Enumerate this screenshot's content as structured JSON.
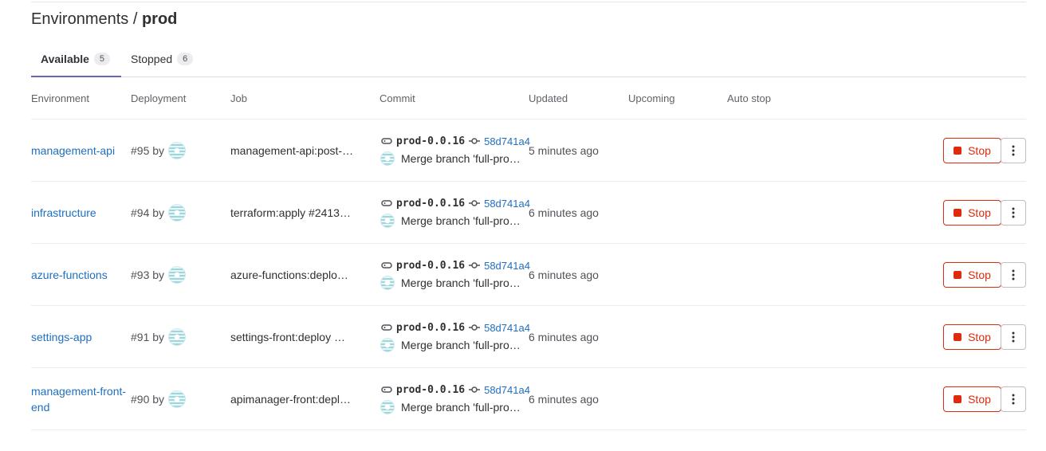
{
  "title": {
    "prefix": "Environments / ",
    "name": "prod"
  },
  "tabs": [
    {
      "label": "Available",
      "count": "5",
      "active": true
    },
    {
      "label": "Stopped",
      "count": "6",
      "active": false
    }
  ],
  "columns": [
    "Environment",
    "Deployment",
    "Job",
    "Commit",
    "Updated",
    "Upcoming",
    "Auto stop"
  ],
  "rows": [
    {
      "environment": "management-api",
      "deployment": "#95 by",
      "job": "management-api:post-…",
      "ref": "prod-0.0.16",
      "sha": "58d741a4",
      "message": "Merge branch 'full-pro…",
      "updated": "5 minutes ago",
      "stop_label": "Stop"
    },
    {
      "environment": "infrastructure",
      "deployment": "#94 by",
      "job": "terraform:apply #2413…",
      "ref": "prod-0.0.16",
      "sha": "58d741a4",
      "message": "Merge branch 'full-pro…",
      "updated": "6 minutes ago",
      "stop_label": "Stop"
    },
    {
      "environment": "azure-functions",
      "deployment": "#93 by",
      "job": "azure-functions:deplo…",
      "ref": "prod-0.0.16",
      "sha": "58d741a4",
      "message": "Merge branch 'full-pro…",
      "updated": "6 minutes ago",
      "stop_label": "Stop"
    },
    {
      "environment": "settings-app",
      "deployment": "#91 by",
      "job": "settings-front:deploy …",
      "ref": "prod-0.0.16",
      "sha": "58d741a4",
      "message": "Merge branch 'full-pro…",
      "updated": "6 minutes ago",
      "stop_label": "Stop"
    },
    {
      "environment": "management-front-end",
      "deployment": "#90 by",
      "job": "apimanager-front:depl…",
      "ref": "prod-0.0.16",
      "sha": "58d741a4",
      "message": "Merge branch 'full-pro…",
      "updated": "6 minutes ago",
      "stop_label": "Stop"
    }
  ],
  "icons": {
    "tag": "tag-icon",
    "commit": "commit-icon",
    "stop": "stop-icon",
    "more": "kebab-menu-icon",
    "avatar": "user-avatar"
  },
  "colors": {
    "link": "#1f6fbf",
    "danger": "#dd2b0e",
    "tab_indicator": "#6666c4"
  }
}
